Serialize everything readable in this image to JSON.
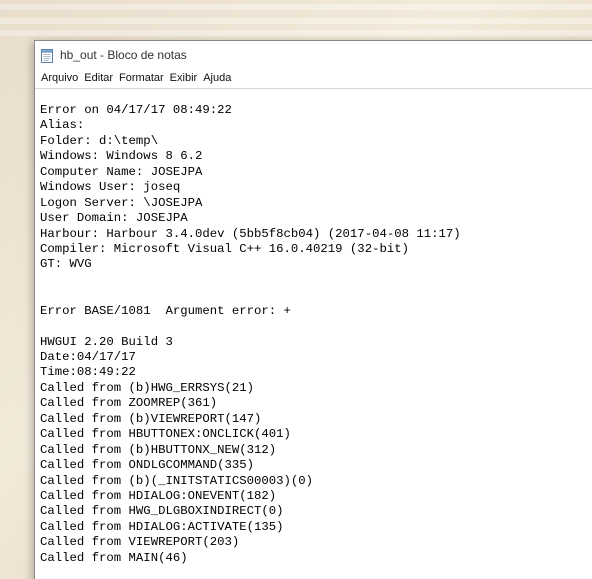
{
  "window": {
    "title": "hb_out - Bloco de notas",
    "icon": "notepad-icon"
  },
  "menu": {
    "items": [
      "Arquivo",
      "Editar",
      "Formatar",
      "Exibir",
      "Ajuda"
    ]
  },
  "document": {
    "lines": [
      "Error on 04/17/17 08:49:22",
      "Alias:",
      "Folder: d:\\temp\\",
      "Windows: Windows 8 6.2",
      "Computer Name: JOSEJPA",
      "Windows User: joseq",
      "Logon Server: \\JOSEJPA",
      "User Domain: JOSEJPA",
      "Harbour: Harbour 3.4.0dev (5bb5f8cb04) (2017-04-08 11:17)",
      "Compiler: Microsoft Visual C++ 16.0.40219 (32-bit)",
      "GT: WVG",
      "",
      "",
      "Error BASE/1081  Argument error: +",
      "",
      "HWGUI 2.20 Build 3",
      "Date:04/17/17",
      "Time:08:49:22",
      "Called from (b)HWG_ERRSYS(21)",
      "Called from ZOOMREP(361)",
      "Called from (b)VIEWREPORT(147)",
      "Called from HBUTTONEX:ONCLICK(401)",
      "Called from (b)HBUTTONX_NEW(312)",
      "Called from ONDLGCOMMAND(335)",
      "Called from (b)(_INITSTATICS00003)(0)",
      "Called from HDIALOG:ONEVENT(182)",
      "Called from HWG_DLGBOXINDIRECT(0)",
      "Called from HDIALOG:ACTIVATE(135)",
      "Called from VIEWREPORT(203)",
      "Called from MAIN(46)"
    ]
  }
}
